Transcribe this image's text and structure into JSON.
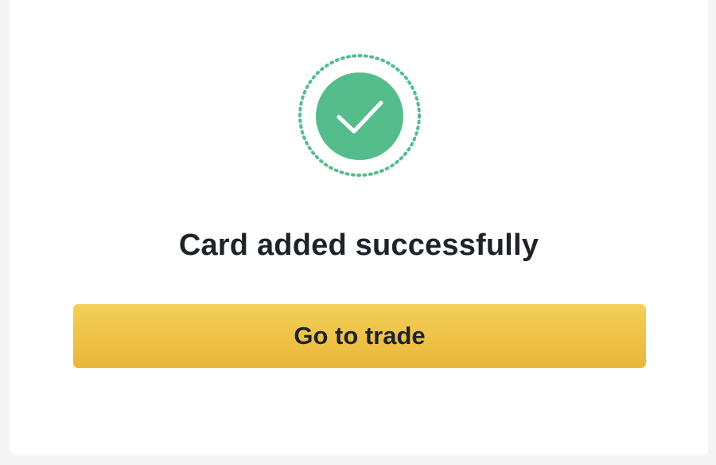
{
  "dialog": {
    "icon": "checkmark-circle-icon",
    "title": "Card added successfully",
    "button_label": "Go to trade"
  },
  "colors": {
    "success_green": "#55bd8b",
    "button_yellow_top": "#f3d056",
    "button_yellow_bottom": "#e9b63a",
    "text_dark": "#1e2329"
  }
}
